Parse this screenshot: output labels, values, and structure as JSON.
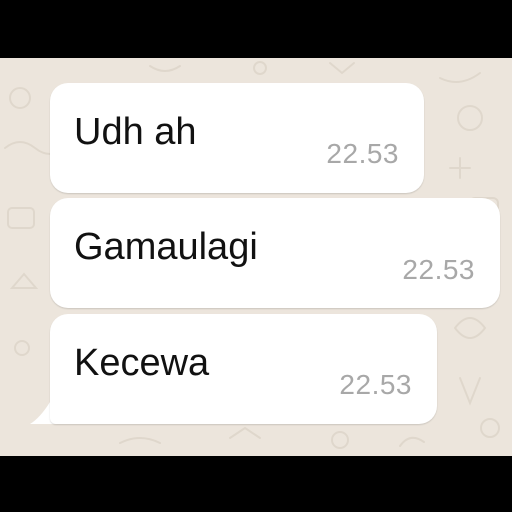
{
  "messages": [
    {
      "text": "Udh ah",
      "time": "22.53"
    },
    {
      "text": "Gamaulagi",
      "time": "22.53"
    },
    {
      "text": "Kecewa",
      "time": "22.53"
    }
  ],
  "colors": {
    "wallpaper": "#ece5dc",
    "bubble": "#ffffff",
    "message_text": "#111111",
    "timestamp": "#a8a8a8"
  }
}
